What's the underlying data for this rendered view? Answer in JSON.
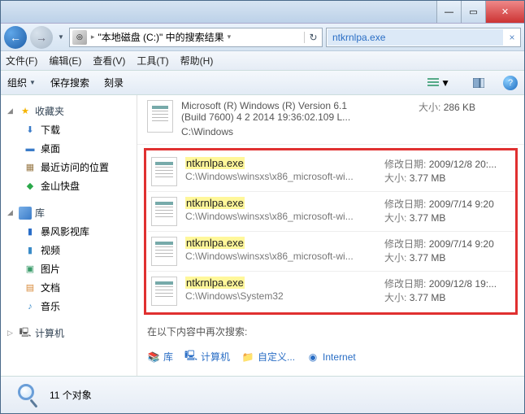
{
  "titlebar": {
    "min": "—",
    "max": "▭",
    "close": "✕"
  },
  "nav": {
    "back": "←",
    "forward": "→",
    "dropdown": "▼",
    "address_icon": "▣",
    "address_text": "\"本地磁盘 (C:)\" 中的搜索结果",
    "refresh": "↻",
    "search_value": "ntkrnlpa.exe",
    "search_clear": "×"
  },
  "menu": {
    "file": "文件(F)",
    "edit": "编辑(E)",
    "view": "查看(V)",
    "tools": "工具(T)",
    "help": "帮助(H)"
  },
  "toolbar": {
    "organize": "组织",
    "save_search": "保存搜索",
    "burn": "刻录"
  },
  "sidebar": {
    "favorites": "收藏夹",
    "fav_items": {
      "downloads": "下载",
      "desktop": "桌面",
      "recent": "最近访问的位置",
      "jinshan": "金山快盘"
    },
    "libraries": "库",
    "lib_items": {
      "baofeng": "暴风影视库",
      "video": "视频",
      "pictures": "图片",
      "documents": "文档",
      "music": "音乐"
    },
    "computer": "计算机"
  },
  "top_result": {
    "desc1": "Microsoft (R) Windows (R) Version 6.1",
    "desc2": "(Build 7600) 4 2 2014 19:36:02.109 L...",
    "path": "C:\\Windows",
    "size_label": "大小:",
    "size": "286 KB"
  },
  "results": [
    {
      "name": "ntkrnlpa.exe",
      "path": "C:\\Windows\\winsxs\\x86_microsoft-wi...",
      "date_label": "修改日期:",
      "date": "2009/12/8 20:...",
      "size_label": "大小:",
      "size": "3.77 MB"
    },
    {
      "name": "ntkrnlpa.exe",
      "path": "C:\\Windows\\winsxs\\x86_microsoft-wi...",
      "date_label": "修改日期:",
      "date": "2009/7/14 9:20",
      "size_label": "大小:",
      "size": "3.77 MB"
    },
    {
      "name": "ntkrnlpa.exe",
      "path": "C:\\Windows\\winsxs\\x86_microsoft-wi...",
      "date_label": "修改日期:",
      "date": "2009/7/14 9:20",
      "size_label": "大小:",
      "size": "3.77 MB"
    },
    {
      "name": "ntkrnlpa.exe",
      "path": "C:\\Windows\\System32",
      "date_label": "修改日期:",
      "date": "2009/12/8 19:...",
      "size_label": "大小:",
      "size": "3.77 MB"
    }
  ],
  "search_again": {
    "label": "在以下内容中再次搜索:",
    "links": {
      "libraries": "库",
      "computer": "计算机",
      "custom": "自定义...",
      "internet": "Internet"
    }
  },
  "footer": {
    "count": "11 个对象"
  }
}
